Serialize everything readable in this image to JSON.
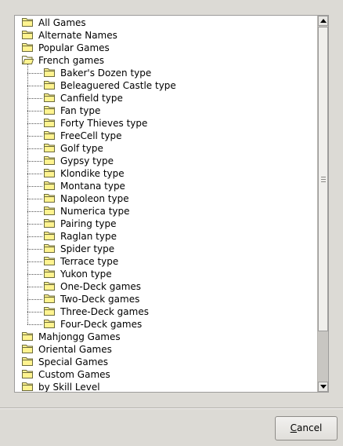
{
  "tree": {
    "top_items_before": [
      {
        "label": "All Games"
      },
      {
        "label": "Alternate Names"
      },
      {
        "label": "Popular Games"
      }
    ],
    "expanded_item": {
      "label": "French games"
    },
    "children": [
      {
        "label": "Baker's Dozen type"
      },
      {
        "label": "Beleaguered Castle type"
      },
      {
        "label": "Canfield type"
      },
      {
        "label": "Fan type"
      },
      {
        "label": "Forty Thieves type"
      },
      {
        "label": "FreeCell type"
      },
      {
        "label": "Golf type"
      },
      {
        "label": "Gypsy type"
      },
      {
        "label": "Klondike type"
      },
      {
        "label": "Montana type"
      },
      {
        "label": "Napoleon type"
      },
      {
        "label": "Numerica type"
      },
      {
        "label": "Pairing type"
      },
      {
        "label": "Raglan type"
      },
      {
        "label": "Spider type"
      },
      {
        "label": "Terrace type"
      },
      {
        "label": "Yukon type"
      },
      {
        "label": "One-Deck games"
      },
      {
        "label": "Two-Deck games"
      },
      {
        "label": "Three-Deck games"
      },
      {
        "label": "Four-Deck games"
      }
    ],
    "top_items_after": [
      {
        "label": "Mahjongg Games"
      },
      {
        "label": "Oriental Games"
      },
      {
        "label": "Special Games"
      },
      {
        "label": "Custom Games"
      },
      {
        "label": "by Skill Level"
      }
    ]
  },
  "scrollbar": {
    "visible_fraction": 0.86,
    "position_fraction": 0.0
  },
  "buttons": {
    "cancel_mnemonic": "C",
    "cancel_rest": "ancel"
  },
  "colors": {
    "folder_fill": "#fff38f",
    "folder_stroke": "#6b6a3c",
    "dialog_bg": "#dcdad5"
  }
}
